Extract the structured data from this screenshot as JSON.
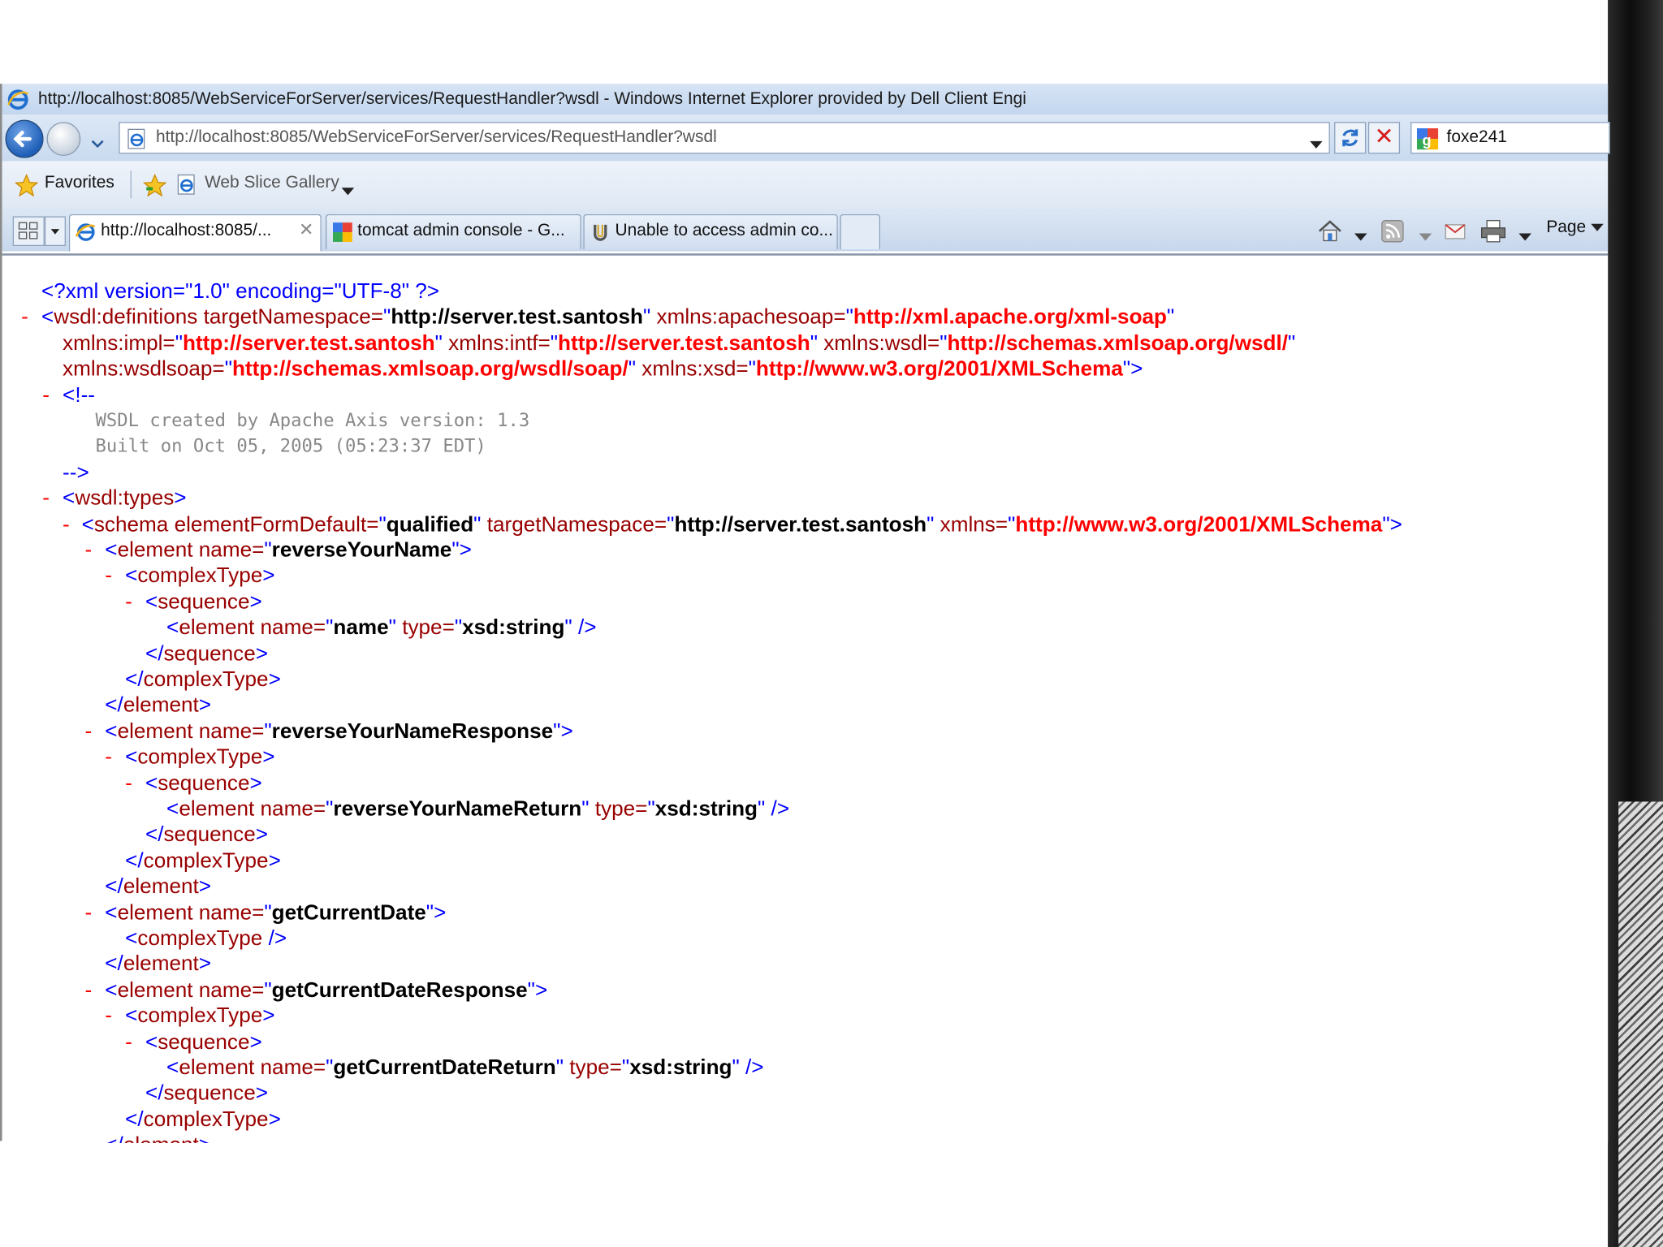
{
  "window": {
    "title": "http://localhost:8085/WebServiceForServer/services/RequestHandler?wsdl - Windows Internet Explorer provided by Dell Client Engi"
  },
  "navbar": {
    "address": "http://localhost:8085/WebServiceForServer/services/RequestHandler?wsdl",
    "search_value": "foxe241"
  },
  "favorites": {
    "favorites_label": "Favorites",
    "web_slice_label": "Web Slice Gallery"
  },
  "tabs": [
    {
      "label": "http://localhost:8085/...",
      "active": true,
      "close": "✕"
    },
    {
      "label": "tomcat admin console - G...",
      "active": false
    },
    {
      "label": "Unable to access admin co...",
      "active": false
    }
  ],
  "command_bar": {
    "page_label": "Page"
  },
  "xml": {
    "collapse_marker": "-",
    "declaration": "<?xml version=\"1.0\" encoding=\"UTF-8\" ?>",
    "definitions": {
      "tag": "wsdl:definitions",
      "targetNamespace": "http://server.test.santosh",
      "xmlns_apachesoap": "http://xml.apache.org/xml-soap",
      "xmlns_impl": "http://server.test.santosh",
      "xmlns_intf": "http://server.test.santosh",
      "xmlns_wsdl": "http://schemas.xmlsoap.org/wsdl/",
      "xmlns_wsdlsoap": "http://schemas.xmlsoap.org/wsdl/soap/",
      "xmlns_xsd": "http://www.w3.org/2001/XMLSchema"
    },
    "comment_open": "<!--",
    "comment_lines": [
      "WSDL created by Apache Axis version: 1.3",
      "Built on Oct 05, 2005 (05:23:37 EDT)"
    ],
    "comment_close": "-->",
    "types_tag": "wsdl:types",
    "schema": {
      "elementFormDefault": "qualified",
      "targetNamespace": "http://server.test.santosh",
      "xmlns": "http://www.w3.org/2001/XMLSchema"
    },
    "elements": [
      {
        "name": "reverseYourName",
        "child": {
          "name": "name",
          "type": "xsd:string"
        }
      },
      {
        "name": "reverseYourNameResponse",
        "child": {
          "name": "reverseYourNameReturn",
          "type": "xsd:string"
        }
      },
      {
        "name": "getCurrentDate"
      },
      {
        "name": "getCurrentDateResponse",
        "child": {
          "name": "getCurrentDateReturn",
          "type": "xsd:string"
        }
      }
    ]
  }
}
